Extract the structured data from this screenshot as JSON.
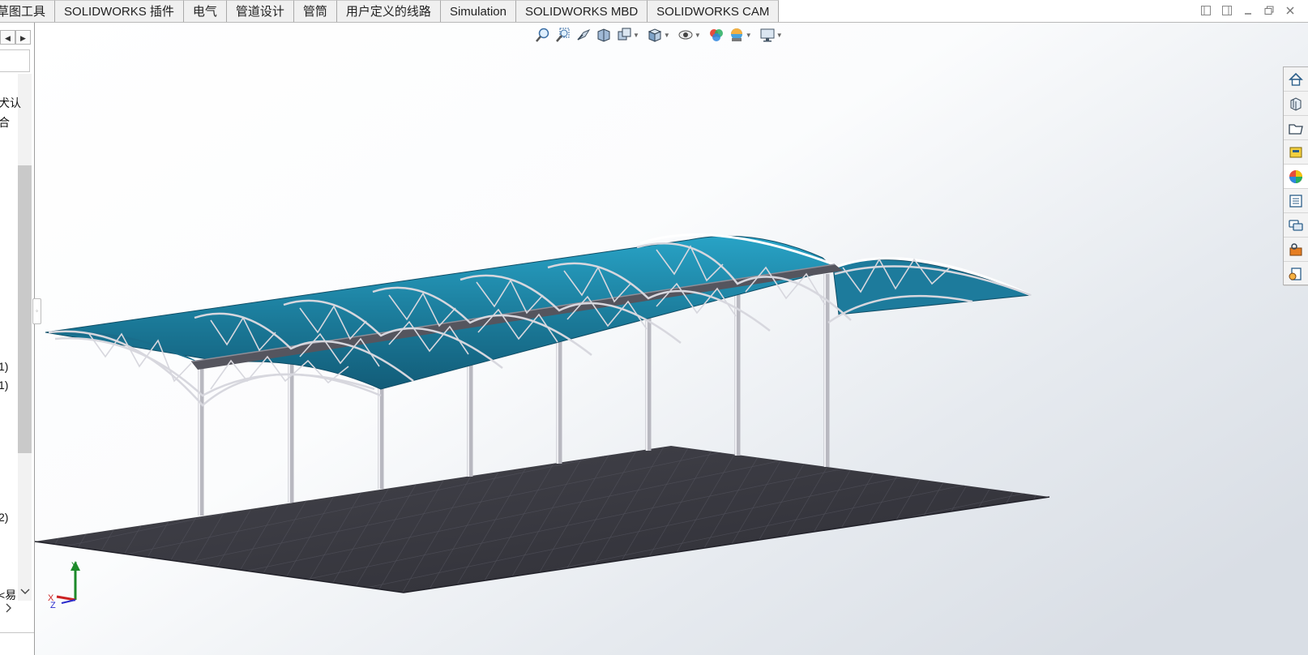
{
  "tabs": [
    "草图工具",
    "SOLIDWORKS 插件",
    "电气",
    "管道设计",
    "管筒",
    "用户定义的线路",
    "Simulation",
    "SOLIDWORKS MBD",
    "SOLIDWORKS CAM"
  ],
  "tree": {
    "line1": "犬认",
    "line2": "合",
    "item_a": "1)",
    "item_b": "1)",
    "item_c": "2)",
    "item_d": "<易"
  },
  "triad": {
    "x": "X",
    "y": "Y",
    "z": "Z"
  },
  "hud_icons": [
    "zoom-to-fit-icon",
    "zoom-to-area-icon",
    "previous-view-icon",
    "section-view-icon",
    "dynamic-annotation-icon",
    "view-orientation-icon",
    "display-style-icon",
    "hide-show-icon",
    "edit-appearance-icon",
    "apply-scene-icon",
    "view-settings-icon"
  ],
  "taskpane_icons": [
    "home-icon",
    "resources-icon",
    "design-library-icon",
    "file-explorer-icon",
    "appearances-icon",
    "custom-properties-icon",
    "forum-icon",
    "toolbox-icon",
    "design-checker-icon"
  ],
  "colors": {
    "roof": "#1f7898",
    "floor": "#3a3a42",
    "steel": "#cfcfd6"
  }
}
